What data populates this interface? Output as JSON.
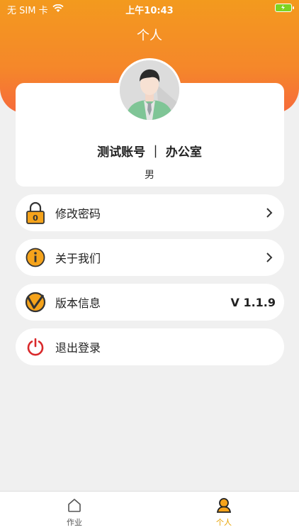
{
  "status_bar": {
    "carrier": "无 SIM 卡",
    "time": "上午10:43",
    "battery_color": "#7ed321"
  },
  "header": {
    "title": "个人",
    "gradient_top": "#f39a1e",
    "gradient_bottom": "#f66a3c"
  },
  "profile": {
    "name": "测试账号 ｜ 办公室",
    "gender": "男",
    "avatar_icon": "avatar-person-icon"
  },
  "menu": [
    {
      "label": "修改密码",
      "icon": "lock-icon",
      "trailing": "chevron"
    },
    {
      "label": "关于我们",
      "icon": "info-icon",
      "trailing": "chevron"
    },
    {
      "label": "版本信息",
      "icon": "version-icon",
      "trailing": "value",
      "value": "V 1.1.9"
    },
    {
      "label": "退出登录",
      "icon": "power-icon",
      "trailing": "none"
    }
  ],
  "tabbar": {
    "tabs": [
      {
        "label": "作业",
        "icon": "home-icon",
        "active": false
      },
      {
        "label": "个人",
        "icon": "person-icon",
        "active": true
      }
    ],
    "active_color": "#e8a200"
  }
}
